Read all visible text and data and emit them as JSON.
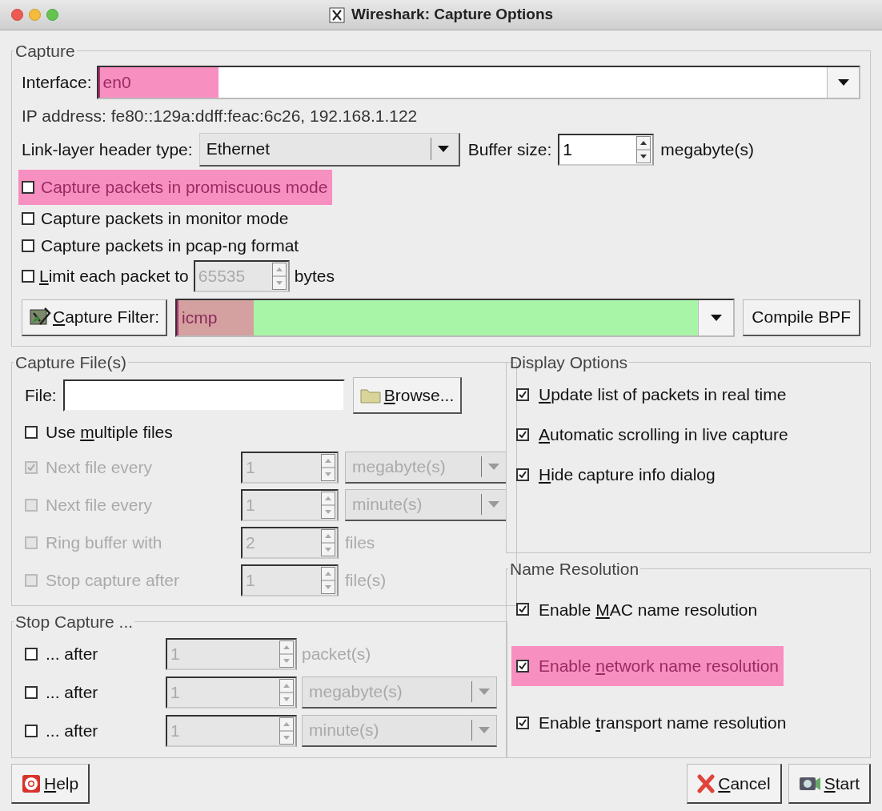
{
  "window": {
    "title": "Wireshark: Capture Options"
  },
  "capture": {
    "title": "Capture",
    "interface": {
      "label": "Interface:",
      "value": "en0",
      "highlighted": true
    },
    "ip_address": "IP address: fe80::129a:ddff:feac:6c26, 192.168.1.122",
    "link_layer": {
      "label": "Link-layer header type:",
      "value": "Ethernet"
    },
    "buffer": {
      "label": "Buffer size:",
      "value": "1",
      "unit": "megabyte(s)"
    },
    "options": [
      {
        "kind": "check",
        "label": {
          "text": "Capture packets in promiscuous mode"
        },
        "checked": false,
        "highlighted": true
      },
      {
        "kind": "check",
        "label": {
          "text": "Capture packets in monitor mode"
        },
        "checked": false,
        "highlighted": false
      },
      {
        "kind": "check",
        "label": {
          "text": "Capture packets in pcap-ng format"
        },
        "checked": false,
        "highlighted": false
      },
      {
        "kind": "limit",
        "label": {
          "key": "L",
          "post": "imit each packet to"
        },
        "checked": false,
        "value": "65535",
        "unit": "bytes"
      }
    ],
    "filter": {
      "button": {
        "key": "C",
        "post": "apture Filter:"
      },
      "value": "icmp",
      "highlighted": true,
      "compile": "Compile BPF"
    }
  },
  "capture_files": {
    "title": "Capture File(s)",
    "file_label": "File:",
    "browse": {
      "key": "B",
      "post": "rowse..."
    },
    "multiple": {
      "label": {
        "pre": "Use ",
        "key": "m",
        "post": "ultiple files"
      },
      "checked": false
    },
    "rows": [
      {
        "kind": "dropdown",
        "label": "Next file every",
        "checked": true,
        "disabled": true,
        "value": "1",
        "unit": "megabyte(s)"
      },
      {
        "kind": "dropdown",
        "label": "Next file every",
        "checked": false,
        "disabled": true,
        "value": "1",
        "unit": "minute(s)"
      },
      {
        "kind": "text",
        "label": "Ring buffer with",
        "checked": false,
        "disabled": true,
        "value": "2",
        "unit": "files"
      },
      {
        "kind": "text",
        "label": "Stop capture after",
        "checked": false,
        "disabled": true,
        "value": "1",
        "unit": "file(s)"
      }
    ]
  },
  "stop_capture": {
    "title": "Stop Capture ...",
    "rows": [
      {
        "kind": "text",
        "label": "... after",
        "checked": false,
        "value": "1",
        "unit": "packet(s)"
      },
      {
        "kind": "dropdown",
        "label": "... after",
        "checked": false,
        "value": "1",
        "unit": "megabyte(s)"
      },
      {
        "kind": "dropdown",
        "label": "... after",
        "checked": false,
        "value": "1",
        "unit": "minute(s)"
      }
    ]
  },
  "display_options": {
    "title": "Display Options",
    "items": [
      {
        "label": {
          "key": "U",
          "post": "pdate list of packets in real time"
        },
        "checked": true,
        "highlighted": false
      },
      {
        "label": {
          "key": "A",
          "post": "utomatic scrolling in live capture"
        },
        "checked": true,
        "highlighted": false
      },
      {
        "label": {
          "key": "H",
          "post": "ide capture info dialog"
        },
        "checked": true,
        "highlighted": false
      }
    ]
  },
  "name_resolution": {
    "title": "Name Resolution",
    "items": [
      {
        "label": {
          "pre": "Enable ",
          "key": "M",
          "post": "AC name resolution"
        },
        "checked": true,
        "highlighted": false
      },
      {
        "label": {
          "pre": "Enable ",
          "key": "n",
          "post": "etwork name resolution"
        },
        "checked": true,
        "highlighted": true
      },
      {
        "label": {
          "pre": "Enable ",
          "key": "t",
          "post": "ransport name resolution"
        },
        "checked": true,
        "highlighted": false
      }
    ]
  },
  "buttons": [
    {
      "kind": "help",
      "label": {
        "key": "H",
        "post": "elp"
      }
    },
    {
      "kind": "cancel",
      "label": {
        "key": "C",
        "post": "ancel"
      }
    },
    {
      "kind": "start",
      "label": {
        "key": "S",
        "post": "tart"
      }
    }
  ]
}
